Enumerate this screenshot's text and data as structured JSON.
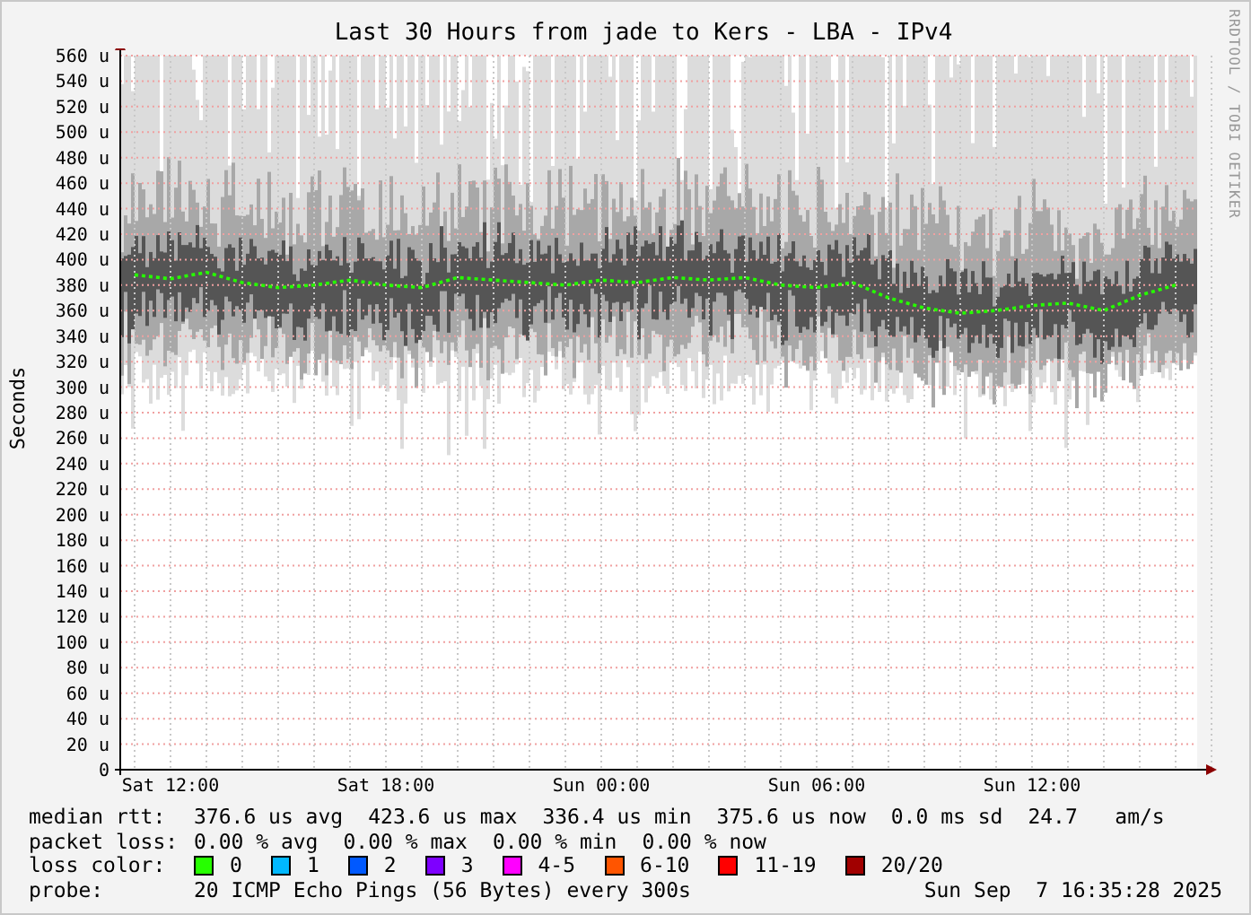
{
  "title": "Last 30 Hours from jade to Kers - LBA - IPv4",
  "watermark": "RRDTOOL / TOBI OETIKER",
  "chart_data": {
    "type": "line",
    "ylabel": "Seconds",
    "ylim": [
      0,
      560
    ],
    "grid": true,
    "categories": [
      null,
      "Sat 12:00",
      null,
      null,
      null,
      null,
      null,
      "Sat 18:00",
      null,
      null,
      null,
      null,
      null,
      "Sun 00:00",
      null,
      null,
      null,
      null,
      null,
      "Sun 06:00",
      null,
      null,
      null,
      null,
      null,
      "Sun 12:00",
      null,
      null,
      null,
      null
    ],
    "series": [
      {
        "color": "#26ff00",
        "line_style": "dotted",
        "values": [
          388,
          385,
          390,
          382,
          378,
          380,
          384,
          380,
          378,
          386,
          384,
          382,
          380,
          384,
          382,
          386,
          384,
          386,
          380,
          378,
          382,
          370,
          362,
          358,
          360,
          364,
          366,
          360,
          372,
          380
        ]
      }
    ],
    "yticks": [
      {
        "value": 560,
        "label": "560 u"
      },
      {
        "value": 540,
        "label": "540 u"
      },
      {
        "value": 520,
        "label": "520 u"
      },
      {
        "value": 500,
        "label": "500 u"
      },
      {
        "value": 480,
        "label": "480 u"
      },
      {
        "value": 460,
        "label": "460 u"
      },
      {
        "value": 440,
        "label": "440 u"
      },
      {
        "value": 420,
        "label": "420 u"
      },
      {
        "value": 400,
        "label": "400 u"
      },
      {
        "value": 380,
        "label": "380 u"
      },
      {
        "value": 360,
        "label": "360 u"
      },
      {
        "value": 340,
        "label": "340 u"
      },
      {
        "value": 320,
        "label": "320 u"
      },
      {
        "value": 300,
        "label": "300 u"
      },
      {
        "value": 280,
        "label": "280 u"
      },
      {
        "value": 260,
        "label": "260 u"
      },
      {
        "value": 240,
        "label": "240 u"
      },
      {
        "value": 220,
        "label": "220 u"
      },
      {
        "value": 200,
        "label": "200 u"
      },
      {
        "value": 180,
        "label": "180 u"
      },
      {
        "value": 160,
        "label": "160 u"
      },
      {
        "value": 140,
        "label": "140 u"
      },
      {
        "value": 120,
        "label": "120 u"
      },
      {
        "value": 100,
        "label": "100 u"
      },
      {
        "value": 80,
        "label": "80 u"
      },
      {
        "value": 60,
        "label": "60 u"
      },
      {
        "value": 40,
        "label": "40 u"
      },
      {
        "value": 20,
        "label": "20 u"
      },
      {
        "value": 0,
        "label": "0"
      }
    ]
  },
  "stats": [
    {
      "label": "median rtt:",
      "values": [
        "376.6 us avg",
        "423.6 us max",
        "336.4 us min",
        "375.6 us now",
        "0.0 ms sd",
        "24.7   am/s"
      ]
    },
    {
      "label": "packet loss:",
      "values": [
        "0.00 % avg",
        "0.00 % max",
        "0.00 % min",
        "0.00 % now"
      ]
    }
  ],
  "loss_color": {
    "label": "loss color:",
    "items": [
      {
        "label": "0",
        "color": "#26ff00"
      },
      {
        "label": "1",
        "color": "#00b8ff"
      },
      {
        "label": "2",
        "color": "#0059ff"
      },
      {
        "label": "3",
        "color": "#7e00ff"
      },
      {
        "label": "4-5",
        "color": "#ff00ff"
      },
      {
        "label": "6-10",
        "color": "#ff5500"
      },
      {
        "label": "11-19",
        "color": "#ff0000"
      },
      {
        "label": "20/20",
        "color": "#a10000"
      }
    ]
  },
  "probe": {
    "label": "probe:",
    "text": "20 ICMP Echo Pings (56 Bytes) every 300s",
    "timestamp": "Sun Sep  7 16:35:28 2025"
  }
}
